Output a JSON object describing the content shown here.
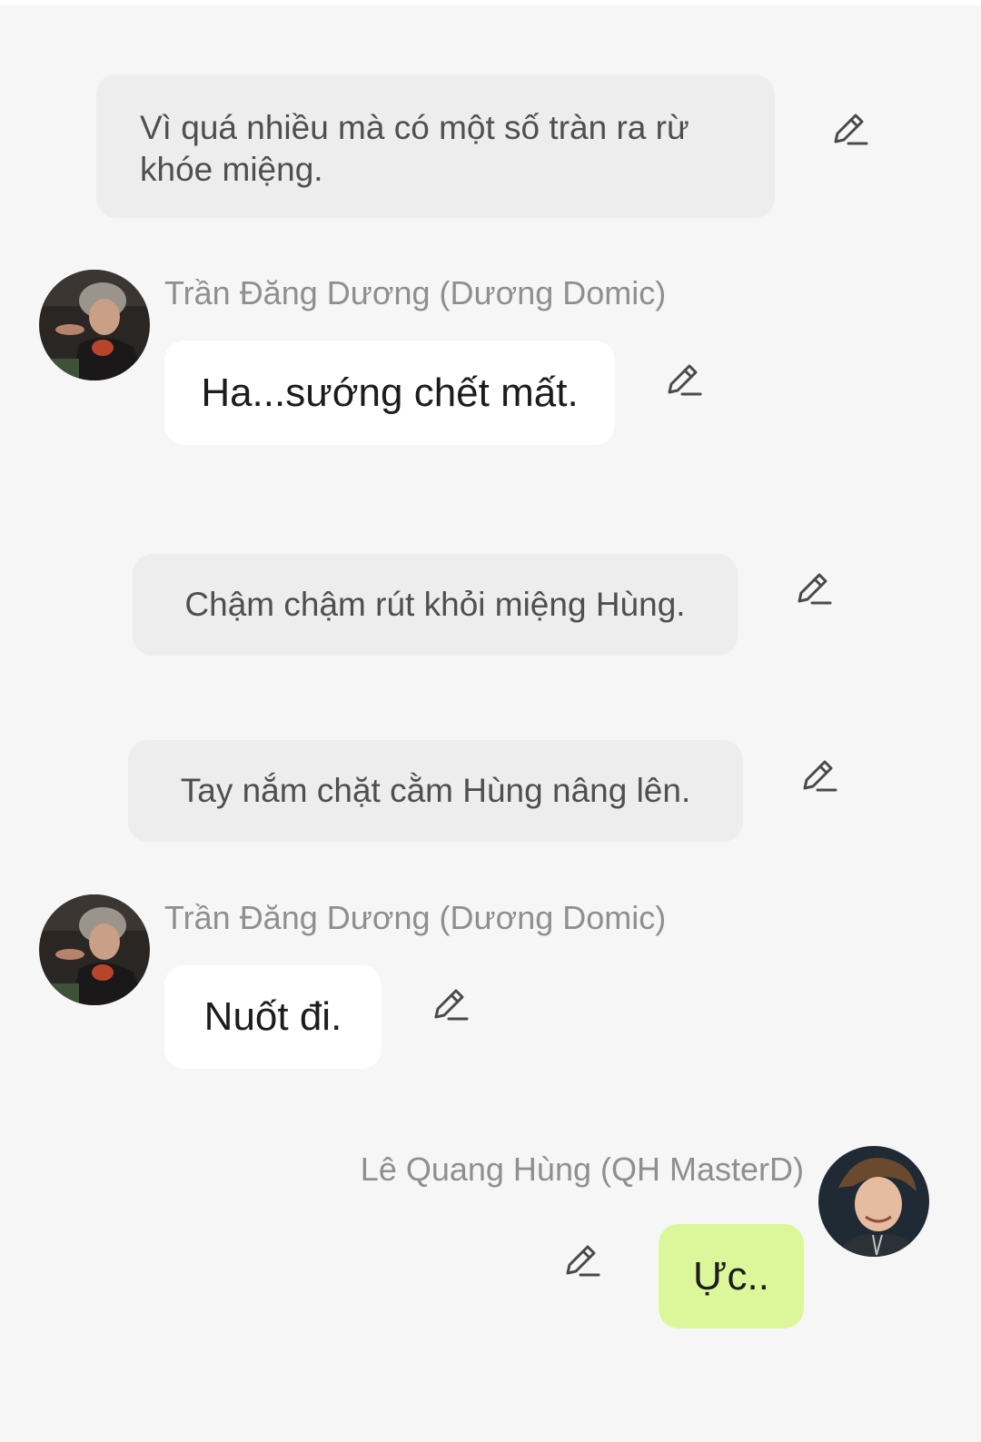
{
  "messages": [
    {
      "type": "narration",
      "text": "Vì quá nhiều mà có một số tràn ra rừ khóe miệng."
    },
    {
      "type": "received",
      "sender": "Trần Đăng Dương (Dương Domic)",
      "text": "Ha...sướng chết mất."
    },
    {
      "type": "narration",
      "text": "Chậm chậm rút khỏi miệng Hùng."
    },
    {
      "type": "narration",
      "text": "Tay nắm chặt cằm Hùng nâng lên."
    },
    {
      "type": "received",
      "sender": "Trần Đăng Dương (Dương Domic)",
      "text": "Nuốt đi."
    },
    {
      "type": "sent",
      "sender": "Lê Quang Hùng (QH MasterD)",
      "text": "Ực.."
    }
  ],
  "icons": {
    "edit": "pencil-edit-icon",
    "avatar": "user-avatar-photo"
  },
  "colors": {
    "background": "#f6f6f6",
    "narration_bubble": "#ededed",
    "received_bubble": "#ffffff",
    "sent_bubble": "#dcf79a",
    "sender_name": "#8f8f8f"
  }
}
